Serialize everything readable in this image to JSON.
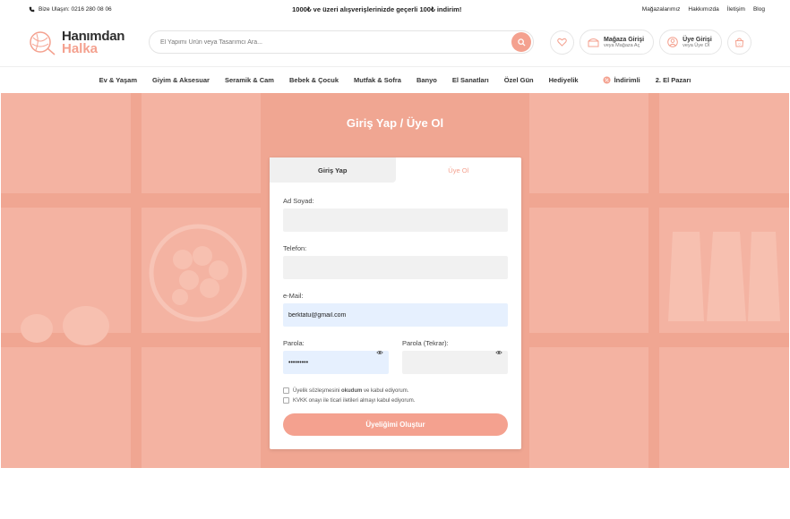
{
  "topbar": {
    "phone": "Bize Ulaşın: 0216 280 08 06",
    "promo": "1000₺ ve üzeri alışverişlerinizde geçerli 100₺ indirim!",
    "links": [
      "Mağazalarımız",
      "Hakkımızda",
      "İletişim",
      "Blog"
    ]
  },
  "logo": {
    "line1": "Hanımdan",
    "line2": "Halka"
  },
  "search": {
    "placeholder": "El Yapımı Ürün veya Tasarımcı Ara..."
  },
  "store_login": {
    "title": "Mağaza Girişi",
    "subtitle": "veya Mağaza Aç"
  },
  "member_login": {
    "title": "Üye Girişi",
    "subtitle": "veya Üye Ol"
  },
  "cart": {
    "count": "0"
  },
  "nav": [
    "Ev & Yaşam",
    "Giyim & Aksesuar",
    "Seramik & Cam",
    "Bebek & Çocuk",
    "Mutfak & Sofra",
    "Banyo",
    "El Sanatları",
    "Özel Gün",
    "Hediyelik",
    "İndirimli",
    "2. El Pazarı"
  ],
  "page_title": "Giriş Yap / Üye Ol",
  "tabs": {
    "login": "Giriş Yap",
    "register": "Üye Ol"
  },
  "form": {
    "name_label": "Ad Soyad:",
    "name_value": "",
    "phone_label": "Telefon:",
    "phone_value": "",
    "email_label": "e-Mail:",
    "email_value": "berktatu@gmail.com",
    "password_label": "Parola:",
    "password_value": "•••••••••",
    "password_confirm_label": "Parola (Tekrar):",
    "password_confirm_value": "",
    "agree_pre": "Üyelik sözleşmesini ",
    "agree_bold": "okudum",
    "agree_post": " ve kabul ediyorum.",
    "kvkk": "KVKK onayı ile ticari iletileri almayı kabul ediyorum.",
    "submit": "Üyeliğimi Oluştur"
  },
  "colors": {
    "accent": "#f4a18f",
    "hero_bg": "#f0a692"
  }
}
